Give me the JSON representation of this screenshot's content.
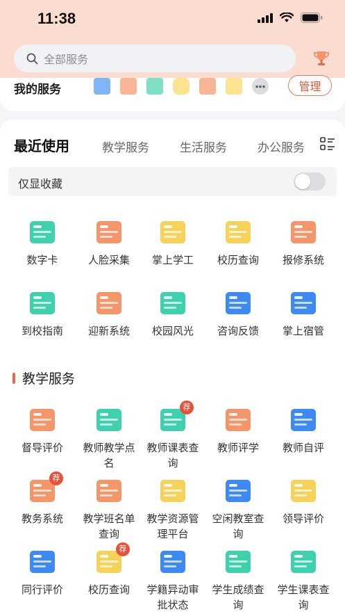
{
  "status": {
    "time": "11:38"
  },
  "search": {
    "placeholder": "全部服务"
  },
  "my_services": {
    "title": "我的服务",
    "manage_label": "管理",
    "mini_icons": [
      "building-icon",
      "id-card-icon",
      "face-card-icon",
      "shield-icon",
      "team-icon",
      "calendar-icon",
      "more-icon"
    ]
  },
  "tabs": [
    "最近使用",
    "教学服务",
    "生活服务",
    "办公服务"
  ],
  "favorites": {
    "label": "仅显收藏",
    "on": false
  },
  "recent": [
    {
      "label": "数字卡",
      "icon": "id-card-icon",
      "color": "#3fd1ad"
    },
    {
      "label": "人脸采集",
      "icon": "face-capture-icon",
      "color": "#f4956a"
    },
    {
      "label": "掌上学工",
      "icon": "student-work-icon",
      "color": "#f7d25a"
    },
    {
      "label": "校历查询",
      "icon": "calendar-icon",
      "color": "#f7d25a"
    },
    {
      "label": "报修系统",
      "icon": "repair-icon",
      "color": "#f4956a"
    },
    {
      "label": "到校指南",
      "icon": "guide-icon",
      "color": "#3fd1ad"
    },
    {
      "label": "迎新系统",
      "icon": "welcome-icon",
      "color": "#f4956a"
    },
    {
      "label": "校园风光",
      "icon": "campus-icon",
      "color": "#3fd1ad"
    },
    {
      "label": "咨询反馈",
      "icon": "chat-icon",
      "color": "#3d8bf2"
    },
    {
      "label": "掌上宿管",
      "icon": "dorm-icon",
      "color": "#3d8bf2"
    }
  ],
  "teaching": {
    "title": "教学服务",
    "items": [
      {
        "label": "督导评价",
        "icon": "book-icon",
        "color": "#f4956a",
        "badge": ""
      },
      {
        "label": "教师教学点名",
        "icon": "roll-call-icon",
        "color": "#3fd1ad",
        "badge": ""
      },
      {
        "label": "教师课表查询",
        "icon": "timetable-search-icon",
        "color": "#3fd1ad",
        "badge": "荐"
      },
      {
        "label": "教师评学",
        "icon": "teacher-grade-icon",
        "color": "#f4956a",
        "badge": ""
      },
      {
        "label": "教师自评",
        "icon": "checklist-icon",
        "color": "#3d8bf2",
        "badge": ""
      },
      {
        "label": "教务系统",
        "icon": "map-icon",
        "color": "#f4956a",
        "badge": "荐"
      },
      {
        "label": "教学班名单查询",
        "icon": "roster-search-icon",
        "color": "#f4956a",
        "badge": ""
      },
      {
        "label": "教学资源管理平台",
        "icon": "resource-icon",
        "color": "#f7d25a",
        "badge": ""
      },
      {
        "label": "空闲教室查询",
        "icon": "classroom-icon",
        "color": "#3d8bf2",
        "badge": ""
      },
      {
        "label": "领导评价",
        "icon": "leader-icon",
        "color": "#f7d25a",
        "badge": ""
      },
      {
        "label": "同行评价",
        "icon": "chart-icon",
        "color": "#3d8bf2",
        "badge": ""
      },
      {
        "label": "校历查询",
        "icon": "calendar-icon",
        "color": "#f7d25a",
        "badge": "荐"
      },
      {
        "label": "学籍异动审批状态",
        "icon": "graduation-icon",
        "color": "#3d8bf2",
        "badge": ""
      },
      {
        "label": "学生成绩查询",
        "icon": "grade-search-icon",
        "color": "#3fd1ad",
        "badge": ""
      },
      {
        "label": "学生课表查询",
        "icon": "student-timetable-icon",
        "color": "#3fd1ad",
        "badge": ""
      }
    ]
  }
}
